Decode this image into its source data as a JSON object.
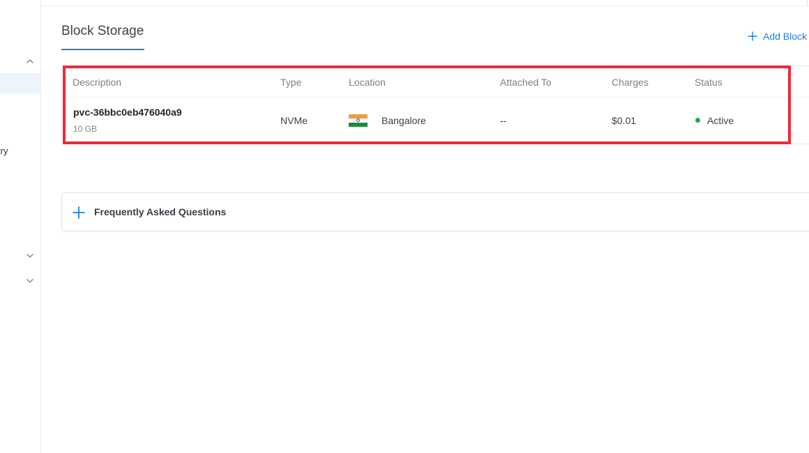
{
  "sidebar": {
    "partial_item_text": "try",
    "icons": [
      "chevron-up-icon",
      "chevron-down-icon",
      "chevron-down-icon"
    ]
  },
  "page": {
    "title": "Block Storage",
    "add_button_label": "Add Block"
  },
  "table": {
    "columns": [
      "Description",
      "Type",
      "Location",
      "Attached To",
      "Charges",
      "Status"
    ],
    "rows": [
      {
        "name": "pvc-36bbc0eb476040a9",
        "size": "10 GB",
        "type": "NVMe",
        "location": "Bangalore",
        "location_flag": "india-flag-icon",
        "attached_to": "--",
        "charges": "$0.01",
        "status": "Active"
      }
    ]
  },
  "faq": {
    "title": "Frequently Asked Questions"
  },
  "colors": {
    "accent": "#1f7fe0",
    "highlight": "#ee2a35",
    "status_active": "#2aa54a"
  }
}
